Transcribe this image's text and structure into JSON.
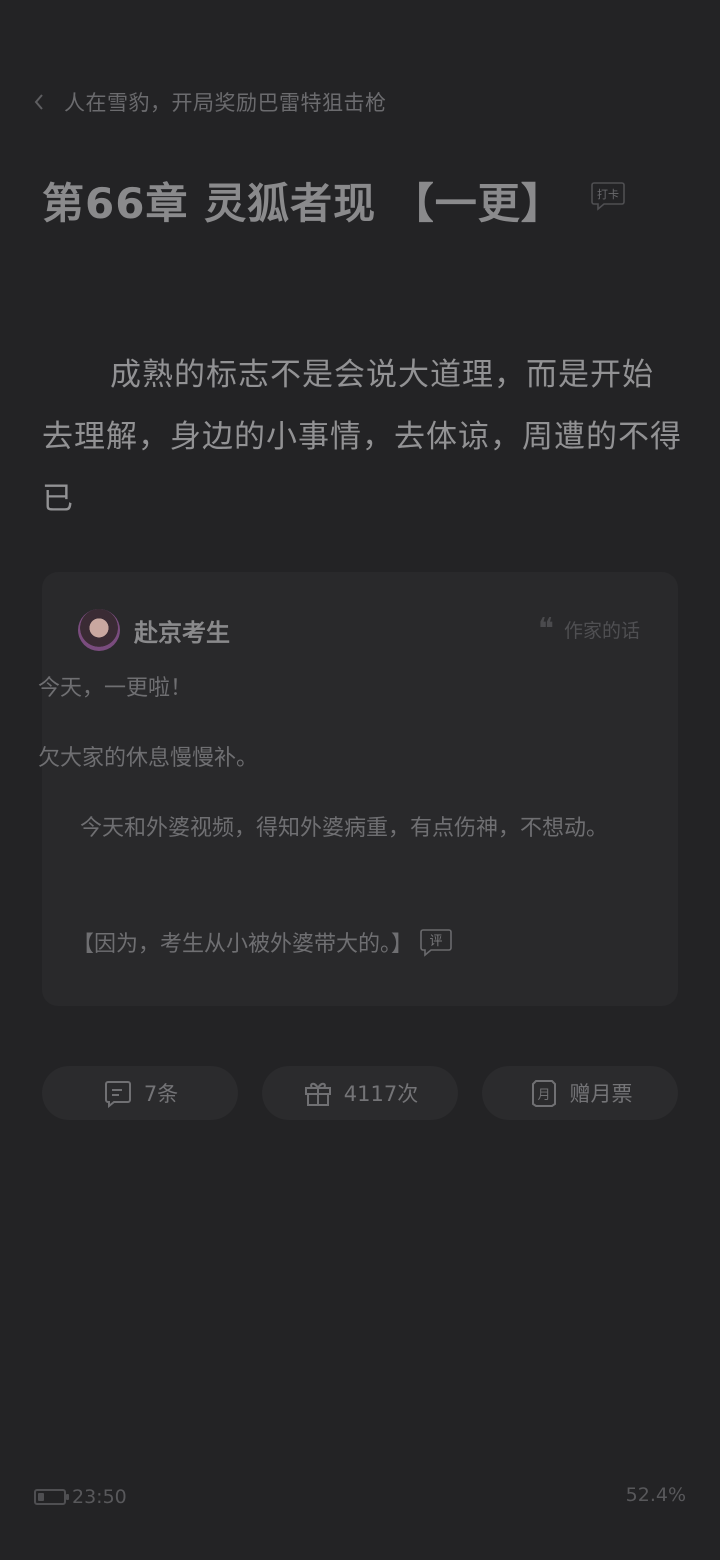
{
  "header": {
    "book_title": "人在雪豹，开局奖励巴雷特狙击枪"
  },
  "chapter": {
    "title": "第66章 灵狐者现 【一更】",
    "checkin_label": "打卡"
  },
  "body": {
    "paragraph": "成熟的标志不是会说大道理，而是开始去理解，身边的小事情，去体谅，周遭的不得已"
  },
  "author_card": {
    "author_name": "赴京考生",
    "section_label": "作家的话",
    "notes": [
      "今天，一更啦！",
      "欠大家的休息慢慢补。",
      "今天和外婆视频，得知外婆病重，有点伤神，不想动。",
      "【因为，考生从小被外婆带大的。】"
    ],
    "comment_badge": "评"
  },
  "actions": {
    "comments_label": "7条",
    "gifts_label": "4117次",
    "monthly_ticket_label": "赠月票"
  },
  "status": {
    "time": "23:50",
    "progress": "52.4%",
    "battery_level": 0.25
  },
  "icons": {
    "back": "chevron-left-icon",
    "quote": "quote-icon",
    "comment": "comment-icon",
    "gift": "gift-icon",
    "ticket": "monthly-ticket-icon",
    "battery": "battery-icon"
  },
  "colors": {
    "background": "#232325",
    "card": "#29292b",
    "button": "#2b2b2d"
  }
}
